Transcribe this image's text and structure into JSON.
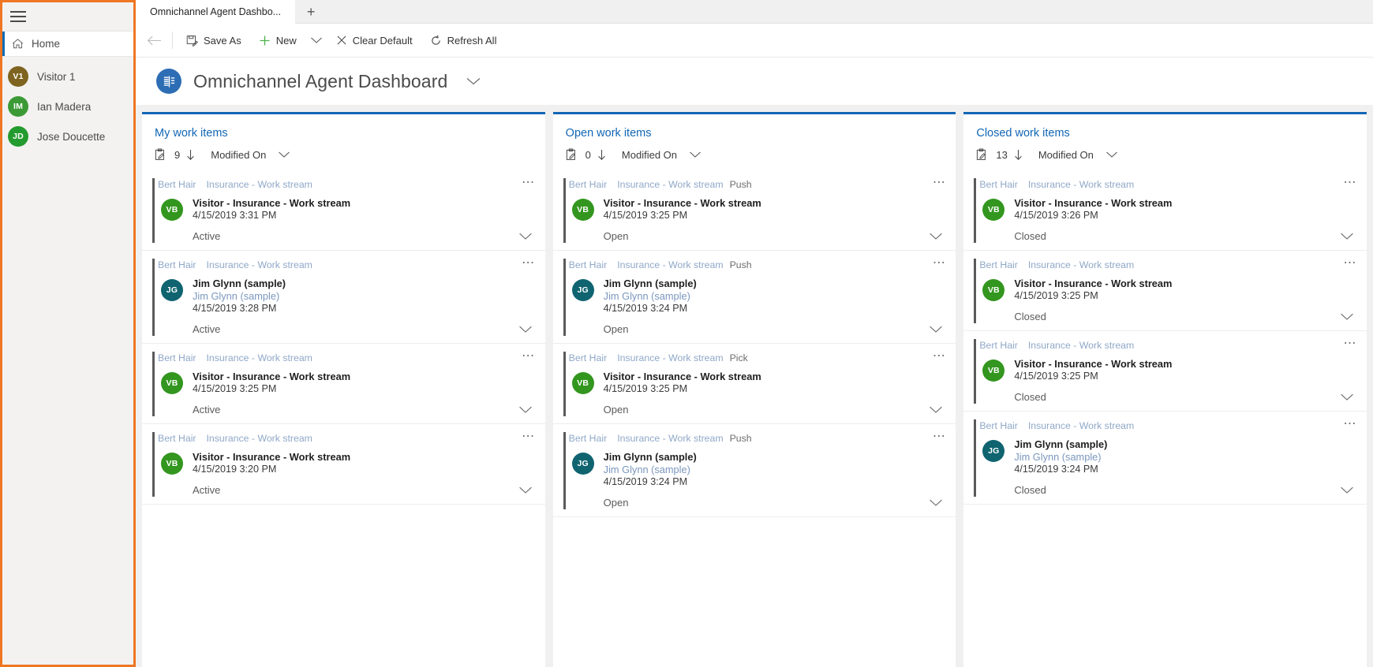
{
  "sidebar": {
    "hamburger_icon": "hamburger-icon",
    "home": {
      "label": "Home",
      "icon": "home-icon"
    },
    "items": [
      {
        "initials": "V1",
        "label": "Visitor 1",
        "color": "#7e6420"
      },
      {
        "initials": "IM",
        "label": "Ian Madera",
        "color": "#3c9a36"
      },
      {
        "initials": "JD",
        "label": "Jose Doucette",
        "color": "#249b2f"
      }
    ]
  },
  "tabs": {
    "items": [
      {
        "label": "Omnichannel Agent Dashbo..."
      }
    ],
    "new_tab_label": "+"
  },
  "commandbar": {
    "back_label": "←",
    "save_as": "Save As",
    "new": "New",
    "new_chevron": "∨",
    "clear_default": "Clear Default",
    "refresh_all": "Refresh All"
  },
  "page": {
    "title": "Omnichannel Agent Dashboard",
    "badge_icon": "dashboard-icon",
    "chevron": "∨"
  },
  "columns": [
    {
      "title": "My work items",
      "count": "9",
      "sort_label": "Modified On",
      "accent": "#1266b5",
      "cards": [
        {
          "owner": "Bert Hair",
          "stream": "Insurance - Work stream",
          "mode": "",
          "avatar": {
            "initials": "VB",
            "color": "#33961f"
          },
          "primary": "Visitor - Insurance - Work stream",
          "secondary": "",
          "time": "4/15/2019 3:31 PM",
          "status": "Active"
        },
        {
          "owner": "Bert Hair",
          "stream": "Insurance - Work stream",
          "mode": "",
          "avatar": {
            "initials": "JG",
            "color": "#0f6470"
          },
          "primary": "Jim Glynn (sample)",
          "secondary": "Jim Glynn (sample)",
          "time": "4/15/2019 3:28 PM",
          "status": "Active"
        },
        {
          "owner": "Bert Hair",
          "stream": "Insurance - Work stream",
          "mode": "",
          "avatar": {
            "initials": "VB",
            "color": "#33961f"
          },
          "primary": "Visitor - Insurance - Work stream",
          "secondary": "",
          "time": "4/15/2019 3:25 PM",
          "status": "Active"
        },
        {
          "owner": "Bert Hair",
          "stream": "Insurance - Work stream",
          "mode": "",
          "avatar": {
            "initials": "VB",
            "color": "#33961f"
          },
          "primary": "Visitor - Insurance - Work stream",
          "secondary": "",
          "time": "4/15/2019 3:20 PM",
          "status": "Active"
        }
      ]
    },
    {
      "title": "Open work items",
      "count": "0",
      "sort_label": "Modified On",
      "accent": "#1266b5",
      "cards": [
        {
          "owner": "Bert Hair",
          "stream": "Insurance - Work stream",
          "mode": "Push",
          "avatar": {
            "initials": "VB",
            "color": "#33961f"
          },
          "primary": "Visitor - Insurance - Work stream",
          "secondary": "",
          "time": "4/15/2019 3:25 PM",
          "status": "Open"
        },
        {
          "owner": "Bert Hair",
          "stream": "Insurance - Work stream",
          "mode": "Push",
          "avatar": {
            "initials": "JG",
            "color": "#0f6470"
          },
          "primary": "Jim Glynn (sample)",
          "secondary": "Jim Glynn (sample)",
          "time": "4/15/2019 3:24 PM",
          "status": "Open"
        },
        {
          "owner": "Bert Hair",
          "stream": "Insurance - Work stream",
          "mode": "Pick",
          "avatar": {
            "initials": "VB",
            "color": "#33961f"
          },
          "primary": "Visitor - Insurance - Work stream",
          "secondary": "",
          "time": "4/15/2019 3:25 PM",
          "status": "Open"
        },
        {
          "owner": "Bert Hair",
          "stream": "Insurance - Work stream",
          "mode": "Push",
          "avatar": {
            "initials": "JG",
            "color": "#0f6470"
          },
          "primary": "Jim Glynn (sample)",
          "secondary": "Jim Glynn (sample)",
          "time": "4/15/2019 3:24 PM",
          "status": "Open"
        }
      ]
    },
    {
      "title": "Closed work items",
      "count": "13",
      "sort_label": "Modified On",
      "accent": "#1266b5",
      "cards": [
        {
          "owner": "Bert Hair",
          "stream": "Insurance - Work stream",
          "mode": "",
          "avatar": {
            "initials": "VB",
            "color": "#33961f"
          },
          "primary": "Visitor - Insurance - Work stream",
          "secondary": "",
          "time": "4/15/2019 3:26 PM",
          "status": "Closed"
        },
        {
          "owner": "Bert Hair",
          "stream": "Insurance - Work stream",
          "mode": "",
          "avatar": {
            "initials": "VB",
            "color": "#33961f"
          },
          "primary": "Visitor - Insurance - Work stream",
          "secondary": "",
          "time": "4/15/2019 3:25 PM",
          "status": "Closed"
        },
        {
          "owner": "Bert Hair",
          "stream": "Insurance - Work stream",
          "mode": "",
          "avatar": {
            "initials": "VB",
            "color": "#33961f"
          },
          "primary": "Visitor - Insurance - Work stream",
          "secondary": "",
          "time": "4/15/2019 3:25 PM",
          "status": "Closed"
        },
        {
          "owner": "Bert Hair",
          "stream": "Insurance - Work stream",
          "mode": "",
          "avatar": {
            "initials": "JG",
            "color": "#0f6470"
          },
          "primary": "Jim Glynn (sample)",
          "secondary": "Jim Glynn (sample)",
          "time": "4/15/2019 3:24 PM",
          "status": "Closed"
        }
      ]
    }
  ]
}
